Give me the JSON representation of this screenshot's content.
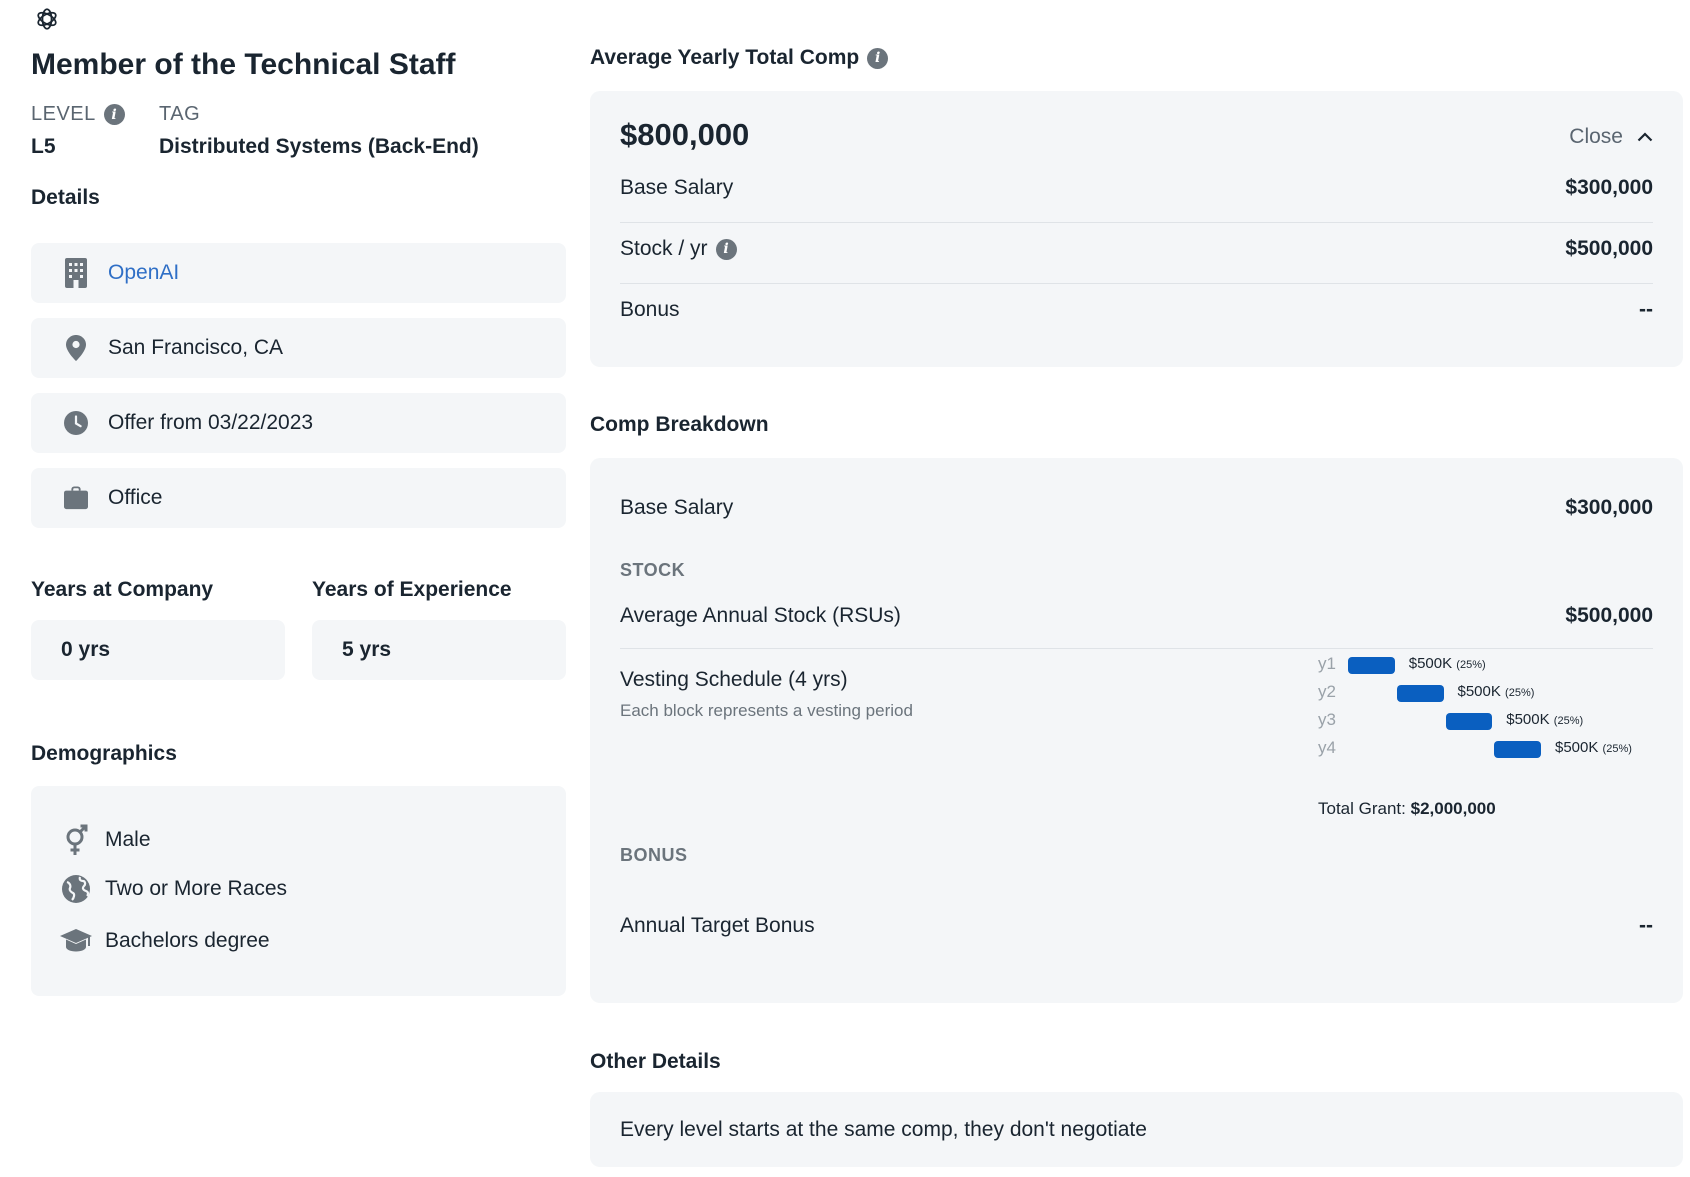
{
  "header": {
    "logo_icon": "openai-logo-icon"
  },
  "job": {
    "title": "Member of the Technical Staff",
    "level_label": "LEVEL",
    "level_value": "L5",
    "tag_label": "TAG",
    "tag_value": "Distributed Systems (Back-End)"
  },
  "details": {
    "heading": "Details",
    "items": [
      {
        "icon": "building-icon",
        "label": "OpenAI"
      },
      {
        "icon": "location-pin-icon",
        "label": "San Francisco, CA"
      },
      {
        "icon": "clock-icon",
        "label": "Offer from 03/22/2023"
      },
      {
        "icon": "briefcase-icon",
        "label": "Office"
      }
    ]
  },
  "experience": {
    "company_label": "Years at Company",
    "company_value": "0 yrs",
    "total_label": "Years of Experience",
    "total_value": "5 yrs"
  },
  "demographics": {
    "heading": "Demographics",
    "items": [
      {
        "icon": "gender-icon",
        "label": "Male"
      },
      {
        "icon": "globe-icon",
        "label": "Two or More Races"
      },
      {
        "icon": "graduation-cap-icon",
        "label": "Bachelors degree"
      }
    ]
  },
  "summary": {
    "heading": "Average Yearly Total Comp",
    "total": "$800,000",
    "close_label": "Close",
    "rows": [
      {
        "label": "Base Salary",
        "value": "$300,000"
      },
      {
        "label": "Stock / yr",
        "value": "$500,000"
      },
      {
        "label": "Bonus",
        "value": "--"
      }
    ]
  },
  "breakdown": {
    "heading": "Comp Breakdown",
    "base_label": "Base Salary",
    "base_value": "$300,000",
    "stock_heading": "STOCK",
    "stock_label": "Average Annual Stock (RSUs)",
    "stock_value": "$500,000",
    "vesting_title": "Vesting Schedule (4 yrs)",
    "vesting_subtitle": "Each block represents a vesting period",
    "vesting": [
      {
        "year": "y1",
        "amount": "$500K",
        "pct": "(25%)",
        "share": 0.25
      },
      {
        "year": "y2",
        "amount": "$500K",
        "pct": "(25%)",
        "share": 0.25
      },
      {
        "year": "y3",
        "amount": "$500K",
        "pct": "(25%)",
        "share": 0.25
      },
      {
        "year": "y4",
        "amount": "$500K",
        "pct": "(25%)",
        "share": 0.25
      }
    ],
    "grant_label": "Total Grant:",
    "grant_value": "$2,000,000",
    "bonus_heading": "BONUS",
    "bonus_label": "Annual Target Bonus",
    "bonus_value": "--"
  },
  "other": {
    "heading": "Other Details",
    "text": "Every level starts at the same comp, they don't negotiate"
  },
  "colors": {
    "accent": "#0a5fc0",
    "link": "#2f6fc6",
    "card_bg": "#f4f6f8",
    "text": "#1a2530",
    "muted": "#6b747c"
  }
}
